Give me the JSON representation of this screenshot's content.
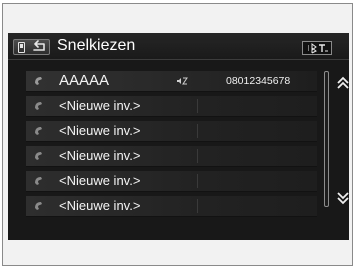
{
  "header": {
    "title": "Snelkiezen",
    "back_icon": "back-arrow-icon",
    "phone_icon": "phone-icon",
    "status_icons": [
      "bluetooth-icon",
      "signal-icon"
    ]
  },
  "speed_dial": [
    {
      "slot": "1",
      "label": "AAAAA",
      "number": "08012345678",
      "voice_tag": true
    },
    {
      "slot": "2",
      "label": "<Nieuwe inv.>",
      "number": "",
      "voice_tag": false
    },
    {
      "slot": "3",
      "label": "<Nieuwe inv.>",
      "number": "",
      "voice_tag": false
    },
    {
      "slot": "4",
      "label": "<Nieuwe inv.>",
      "number": "",
      "voice_tag": false
    },
    {
      "slot": "5",
      "label": "<Nieuwe inv.>",
      "number": "",
      "voice_tag": false
    },
    {
      "slot": "6",
      "label": "<Nieuwe inv.>",
      "number": "",
      "voice_tag": false
    }
  ],
  "scroll": {
    "up_icon": "chevron-double-up-icon",
    "down_icon": "chevron-double-down-icon"
  },
  "colors": {
    "screen_bg": "#181818",
    "row_bg": "#2e2e2e",
    "text": "#ffffff"
  }
}
